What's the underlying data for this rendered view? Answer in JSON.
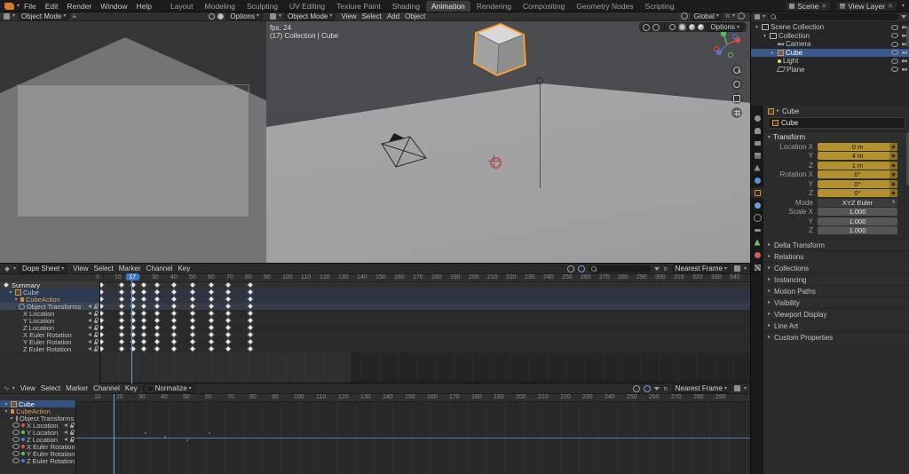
{
  "topbar": {
    "menus": [
      "File",
      "Edit",
      "Render",
      "Window",
      "Help"
    ],
    "workspaces": [
      "Layout",
      "Modeling",
      "Sculpting",
      "UV Editing",
      "Texture Paint",
      "Shading",
      "Animation",
      "Rendering",
      "Compositing",
      "Geometry Nodes",
      "Scripting"
    ],
    "active_workspace": "Animation",
    "scene_label": "Scene",
    "view_layer_label": "View Layer"
  },
  "camera_view": {
    "mode": "Object Mode",
    "options_label": "Options"
  },
  "viewport": {
    "mode": "Object Mode",
    "menus": [
      "View",
      "Select",
      "Add",
      "Object"
    ],
    "orientation": "Global",
    "options_label": "Options",
    "fps_text": "fps: 24",
    "info_text": "(17) Collection | Cube"
  },
  "outliner": {
    "rows": [
      {
        "label": "Scene Collection",
        "depth": 0,
        "icon": "collection",
        "expanded": true
      },
      {
        "label": "Collection",
        "depth": 1,
        "icon": "collection",
        "expanded": true
      },
      {
        "label": "Camera",
        "depth": 2,
        "icon": "camera"
      },
      {
        "label": "Cube",
        "depth": 2,
        "icon": "cube",
        "selected": true,
        "expandable": true
      },
      {
        "label": "Light",
        "depth": 2,
        "icon": "light"
      },
      {
        "label": "Plane",
        "depth": 2,
        "icon": "plane"
      }
    ]
  },
  "properties": {
    "tabs": [
      "tool",
      "render",
      "output",
      "view-layer",
      "scene",
      "world",
      "object",
      "modifiers",
      "physics",
      "constraints",
      "data",
      "material",
      "texture"
    ],
    "active_tab": "object",
    "breadcrumb_object": "Cube",
    "name_value": "Cube",
    "transform_title": "Transform",
    "transform_rows": [
      {
        "label": "Location X",
        "value": "0 m",
        "style": "animated"
      },
      {
        "label": "Y",
        "value": "4 m",
        "style": "animated"
      },
      {
        "label": "Z",
        "value": "1 m",
        "style": "animated"
      },
      {
        "label": "Rotation X",
        "value": "0°",
        "style": "animated"
      },
      {
        "label": "Y",
        "value": "0°",
        "style": "animated"
      },
      {
        "label": "Z",
        "value": "0°",
        "style": "animated"
      },
      {
        "label": "Mode",
        "value": "XYZ Euler",
        "style": "dropdown"
      },
      {
        "label": "Scale X",
        "value": "1.000",
        "style": "number"
      },
      {
        "label": "Y",
        "value": "1.000",
        "style": "number"
      },
      {
        "label": "Z",
        "value": "1.000",
        "style": "number"
      }
    ],
    "sections": [
      "Delta Transform",
      "Relations",
      "Collections",
      "Instancing",
      "Motion Paths",
      "Visibility",
      "Viewport Display",
      "Line Art",
      "Custom Properties"
    ]
  },
  "dope_sheet": {
    "editor_label": "Dope Sheet",
    "menus": [
      "View",
      "Select",
      "Marker",
      "Channel",
      "Key"
    ],
    "snap_label": "Nearest Frame",
    "current_frame": 17,
    "action_range": [
      1,
      135
    ],
    "ruler": [
      0,
      10,
      20,
      30,
      40,
      50,
      60,
      70,
      80,
      90,
      100,
      110,
      120,
      130,
      140,
      150,
      160,
      170,
      180,
      190,
      200,
      210,
      220,
      230,
      240,
      250,
      260,
      270,
      280,
      290,
      300,
      310,
      320,
      330,
      340
    ],
    "keyframes": [
      1,
      12,
      18,
      24,
      31,
      40,
      50,
      60,
      69,
      81
    ],
    "channels": [
      {
        "label": "Summary",
        "kind": "summary"
      },
      {
        "label": "Cube",
        "kind": "object",
        "icon": "cube",
        "expanded": true,
        "selected": true
      },
      {
        "label": "CubeAction",
        "kind": "action",
        "icon": "action",
        "expanded": true,
        "selected": true
      },
      {
        "label": "Object Transforms",
        "kind": "group",
        "icon": "otf",
        "selected": true,
        "icons": [
          "speaker",
          "lock"
        ]
      },
      {
        "label": "X Location",
        "kind": "fcurve",
        "icons": [
          "speaker",
          "lock"
        ]
      },
      {
        "label": "Y Location",
        "kind": "fcurve",
        "icons": [
          "speaker",
          "lock"
        ]
      },
      {
        "label": "Z Location",
        "kind": "fcurve",
        "icons": [
          "speaker",
          "lock"
        ]
      },
      {
        "label": "X Euler Rotation",
        "kind": "fcurve",
        "icons": [
          "speaker",
          "lock"
        ]
      },
      {
        "label": "Y Euler Rotation",
        "kind": "fcurve",
        "icons": [
          "speaker",
          "lock"
        ]
      },
      {
        "label": "Z Euler Rotation",
        "kind": "fcurve",
        "icons": [
          "speaker",
          "lock"
        ]
      }
    ]
  },
  "graph_editor": {
    "menus": [
      "View",
      "Select",
      "Marker",
      "Channel",
      "Key"
    ],
    "normalize_label": "Normalize",
    "snap_label": "Nearest Frame",
    "current_frame": 17,
    "ruler": [
      10,
      20,
      30,
      40,
      50,
      60,
      70,
      80,
      90,
      100,
      110,
      120,
      130,
      140,
      150,
      160,
      170,
      180,
      190,
      200,
      210,
      220,
      230,
      240,
      250,
      260,
      270,
      280,
      290
    ],
    "channels": [
      {
        "label": "Cube",
        "icon": "cube",
        "expanded": true,
        "selected": true
      },
      {
        "label": "CubeAction",
        "icon": "action",
        "expanded": true,
        "action": true
      },
      {
        "label": "Object Transforms",
        "icon": "otf",
        "expanded": true,
        "icons": [
          "speaker",
          "lock"
        ]
      },
      {
        "label": "X Location",
        "color": "#e5484d",
        "icons": [
          "speaker",
          "lock"
        ]
      },
      {
        "label": "Y Location",
        "color": "#58c45b",
        "icons": [
          "speaker",
          "lock"
        ]
      },
      {
        "label": "Z Location",
        "color": "#4a7bd9",
        "icons": [
          "speaker",
          "lock"
        ]
      },
      {
        "label": "X Euler Rotation",
        "color": "#e5484d",
        "icons": [
          "speaker",
          "lock"
        ]
      },
      {
        "label": "Y Euler Rotation",
        "color": "#58c45b",
        "icons": [
          "speaker",
          "lock"
        ]
      },
      {
        "label": "Z Euler Rotation",
        "color": "#4a7bd9",
        "icons": [
          "speaker",
          "lock"
        ]
      }
    ]
  },
  "colors": {
    "accent": "#4a90d9",
    "selection": "#3a5a8c",
    "keyframe": "#e9e9e9",
    "animated_field": "#b3912f",
    "object_outline": "#ff9d2e"
  }
}
